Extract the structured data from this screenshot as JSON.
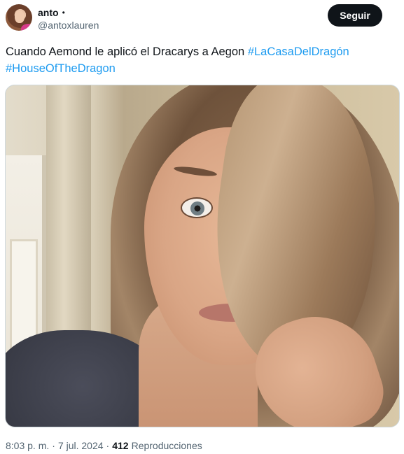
{
  "author": {
    "display_name": "anto",
    "dot": "•",
    "handle": "@antoxlauren"
  },
  "follow_button": {
    "label": "Seguir"
  },
  "tweet": {
    "text_plain": "Cuando Aemond le aplicó el Dracarys a Aegon ",
    "hashtag_1": "#LaCasaDelDragón",
    "hashtag_2": "#HouseOfTheDragon"
  },
  "meta": {
    "time": "8:03 p. m.",
    "separator": "·",
    "date": "7 jul. 2024",
    "separator_2": "·",
    "views_count": "412",
    "views_label": "Reproducciones"
  },
  "colors": {
    "text": "#0f1419",
    "secondary": "#536471",
    "link": "#1d9bf0",
    "button_bg": "#0f1419"
  }
}
